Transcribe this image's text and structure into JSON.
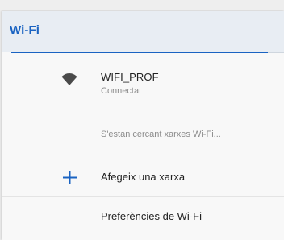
{
  "header": {
    "title": "Wi-Fi"
  },
  "colors": {
    "accent": "#1a63c2",
    "header_bg": "#e8edf3",
    "secondary_text": "#8c8c8c"
  },
  "networks": [
    {
      "name": "WIFI_PROF",
      "status": "Connectat",
      "icon": "wifi-icon"
    }
  ],
  "searching_text": "S'estan cercant xarxes Wi-Fi...",
  "add_network": {
    "label": "Afegeix una xarxa",
    "icon": "plus-icon"
  },
  "preferences": {
    "label": "Preferències de Wi-Fi"
  }
}
